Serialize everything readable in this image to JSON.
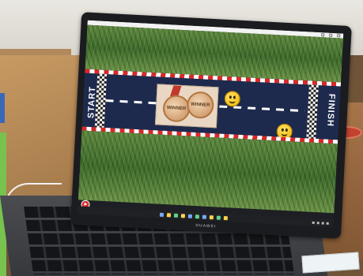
{
  "app": {
    "track_labels": {
      "start": "START",
      "finish": "FINISH"
    },
    "medal_texts": [
      "WINNER",
      "WINNER"
    ],
    "brand": "HUAWEI"
  },
  "colors": {
    "track": "#1e2a4d",
    "curb_red": "#d72a2a",
    "grass": "#4f7d35",
    "taskbar": "#202124",
    "play_button": "#d62b2b"
  },
  "icons": [
    "play-icon",
    "smiley-icon",
    "medal-icon"
  ]
}
